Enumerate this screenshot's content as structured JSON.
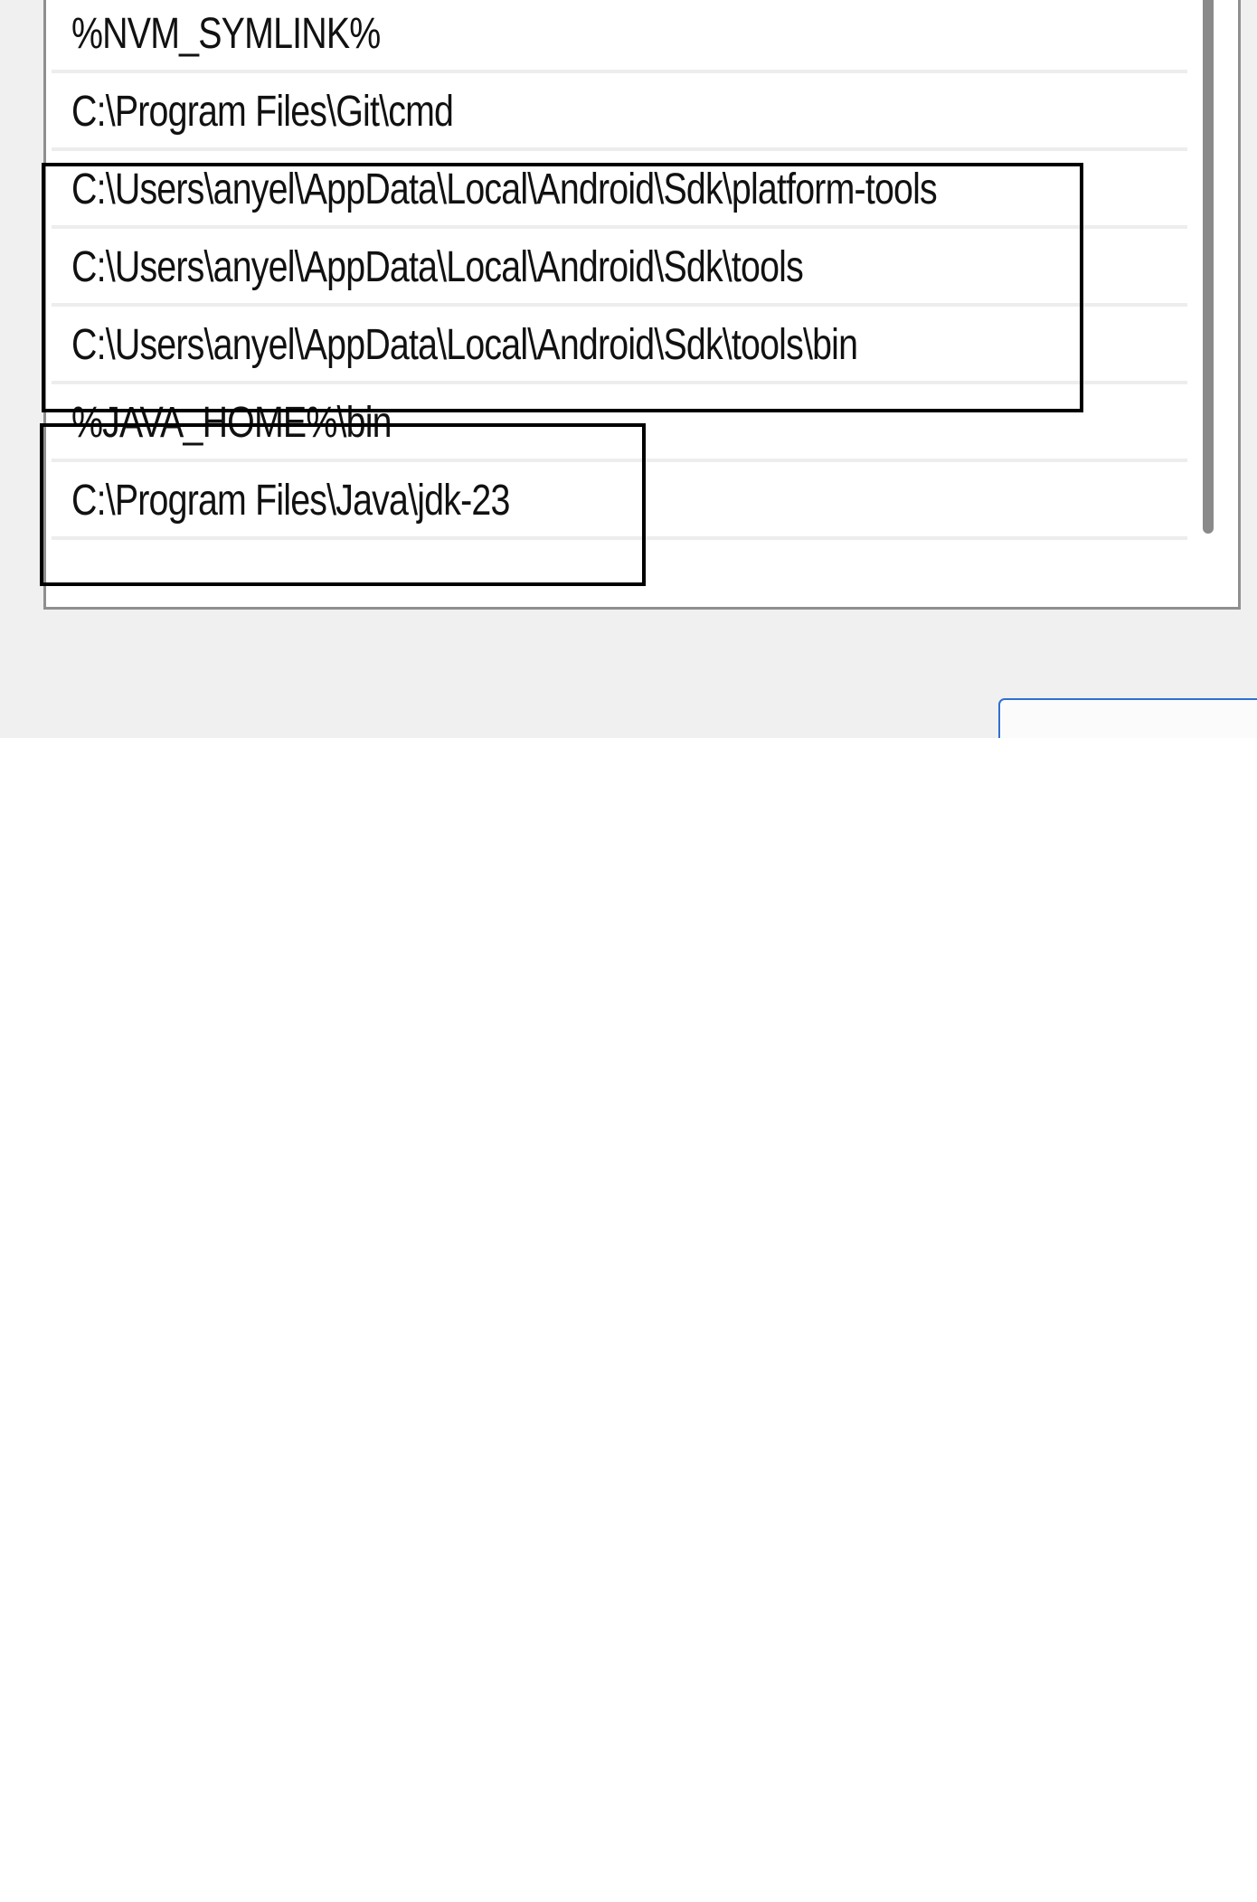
{
  "path_list": {
    "items": [
      "%NVM_SYMLINK%",
      "C:\\Program Files\\Git\\cmd",
      "C:\\Users\\anyel\\AppData\\Local\\Android\\Sdk\\platform-tools",
      "C:\\Users\\anyel\\AppData\\Local\\Android\\Sdk\\tools",
      "C:\\Users\\anyel\\AppData\\Local\\Android\\Sdk\\tools\\bin",
      "%JAVA_HOME%\\bin",
      "C:\\Program Files\\Java\\jdk-23"
    ]
  },
  "colors": {
    "dialog_background": "#f0f0f0",
    "list_background": "#ffffff",
    "row_divider": "#ededed",
    "annotation_border": "#000000",
    "button_accent": "#2f6fd0"
  }
}
